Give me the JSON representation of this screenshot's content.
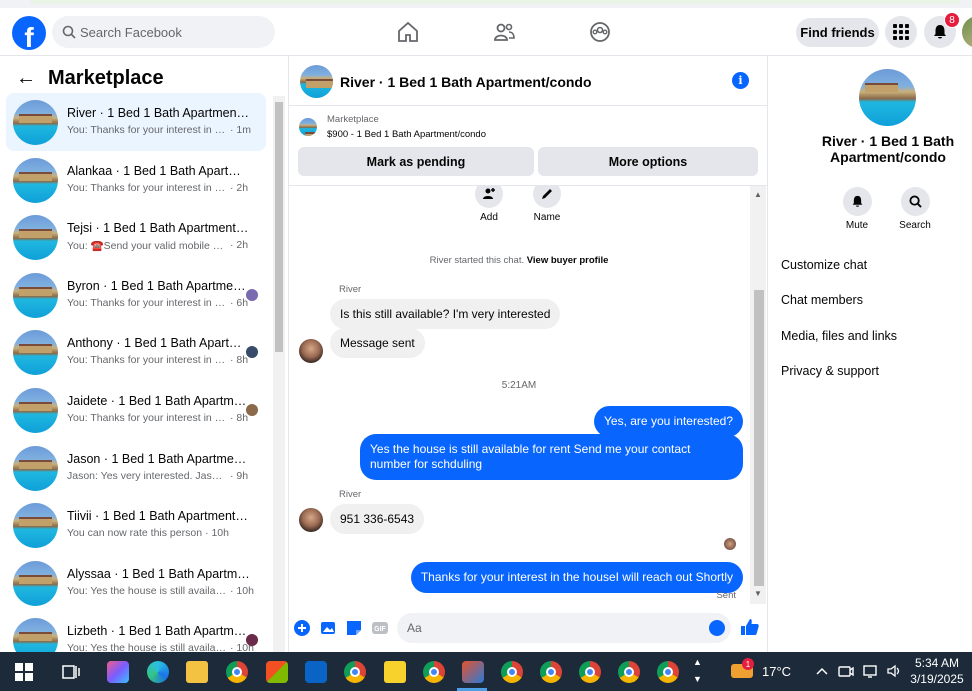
{
  "topbar": {
    "logo": "f",
    "search_placeholder": "Search Facebook",
    "find_friends": "Find friends",
    "notif_count": "8",
    "colors": {
      "brand": "#0866ff",
      "badge": "#e41e3f"
    }
  },
  "marketplace": {
    "title": "Marketplace",
    "conversations": [
      {
        "name": "River · 1 Bed 1 Bath Apartment/condo",
        "preview": "You: Thanks for your interest in the house",
        "ago": "· 1m",
        "active": true
      },
      {
        "name": "Alankaa · 1 Bed 1 Bath Apartment/condo",
        "preview": "You: Thanks for your interest in the house",
        "ago": "· 2h"
      },
      {
        "name": "Tejsi · 1 Bed 1 Bath Apartment/condo",
        "preview": "You: ☎️Send your valid mobile number",
        "ago": "· 2h"
      },
      {
        "name": "Byron · 1 Bed 1 Bath Apartment/condo",
        "preview": "You: Thanks for your interest in the house",
        "ago": "· 6h",
        "avatar": "#7a6ab0"
      },
      {
        "name": "Anthony · 1 Bed 1 Bath Apartment/condo",
        "preview": "You: Thanks for your interest in the house",
        "ago": "· 8h",
        "avatar": "#3a4a6a"
      },
      {
        "name": "Jaidete · 1 Bed 1 Bath Apartment/condo",
        "preview": "You: Thanks for your interest in the house",
        "ago": "· 8h",
        "avatar": "#8a6a4a"
      },
      {
        "name": "Jason · 1 Bed 1 Bath Apartment/condo",
        "preview": "Jason: Yes very interested. Jason 9...",
        "ago": "· 9h"
      },
      {
        "name": "Tiivii · 1 Bed 1 Bath Apartment/condo",
        "preview": "You can now rate this person",
        "ago": "· 10h"
      },
      {
        "name": "Alyssaa · 1 Bed 1 Bath Apartment/condo",
        "preview": "You: Yes the house is still available",
        "ago": "· 10h"
      },
      {
        "name": "Lizbeth · 1 Bed 1 Bath Apartment/condo",
        "preview": "You: Yes the house is still available",
        "ago": "· 10h",
        "avatar": "#6a2a4a"
      }
    ]
  },
  "chat": {
    "title": "River · 1 Bed 1 Bath Apartment/condo",
    "listing_source": "Marketplace",
    "listing_price": "$900 - 1 Bed 1 Bath Apartment/condo",
    "mark_pending": "Mark as pending",
    "more_options": "More options",
    "quick_add": "Add",
    "quick_name": "Name",
    "started_text": "River started this chat.",
    "buyer_profile": "View buyer profile",
    "sender_label": "River",
    "msg_in_1": "Is this still available? I'm very interested",
    "msg_in_2": "Message sent",
    "time_1": "5:21AM",
    "msg_out_1": "Yes, are you interested?",
    "msg_out_2": "Yes the house is still available for rent Send me your contact number for schduling",
    "msg_in_3": "951 336-6543",
    "msg_out_3": "Thanks for your interest in the houseI will reach out Shortly",
    "sent_label": "Sent",
    "composer_placeholder": "Aa"
  },
  "details": {
    "title": "River · 1 Bed 1 Bath Apartment/condo",
    "mute": "Mute",
    "search": "Search",
    "links": [
      "Customize chat",
      "Chat members",
      "Media, files and links",
      "Privacy & support"
    ]
  },
  "taskbar": {
    "temperature": "17°C",
    "time": "5:34 AM",
    "date": "3/19/2025",
    "weather_badge": "1"
  }
}
